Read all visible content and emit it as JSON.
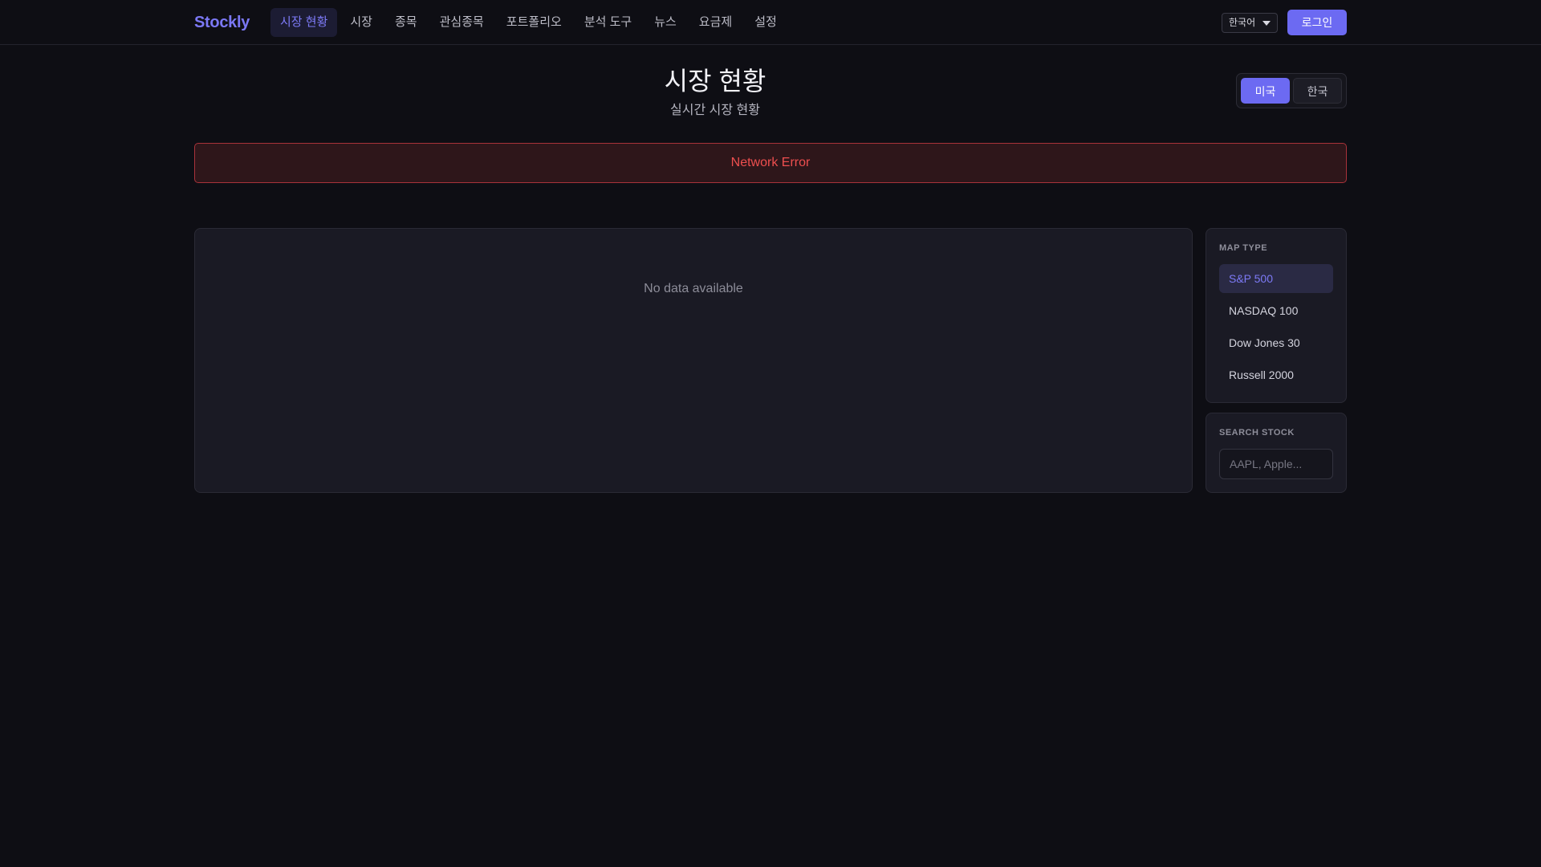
{
  "brand": "Stockly",
  "nav": {
    "items": [
      {
        "label": "시장 현황",
        "active": true
      },
      {
        "label": "시장",
        "active": false
      },
      {
        "label": "종목",
        "active": false
      },
      {
        "label": "관심종목",
        "active": false
      },
      {
        "label": "포트폴리오",
        "active": false
      },
      {
        "label": "분석 도구",
        "active": false
      },
      {
        "label": "뉴스",
        "active": false
      },
      {
        "label": "요금제",
        "active": false
      },
      {
        "label": "설정",
        "active": false
      }
    ]
  },
  "language": {
    "selected": "한국어"
  },
  "login_label": "로그인",
  "page": {
    "title": "시장 현황",
    "subtitle": "실시간 시장 현황"
  },
  "market_toggle": {
    "options": [
      {
        "label": "미국",
        "active": true
      },
      {
        "label": "한국",
        "active": false
      }
    ]
  },
  "error_message": "Network Error",
  "map_panel": {
    "empty_message": "No data available"
  },
  "map_type": {
    "label": "MAP TYPE",
    "options": [
      {
        "label": "S&P 500",
        "active": true
      },
      {
        "label": "NASDAQ 100",
        "active": false
      },
      {
        "label": "Dow Jones 30",
        "active": false
      },
      {
        "label": "Russell 2000",
        "active": false
      }
    ]
  },
  "search": {
    "label": "SEARCH STOCK",
    "placeholder": "AAPL, Apple...",
    "value": ""
  },
  "colors": {
    "accent": "#6c6af2",
    "background": "#0e0e14",
    "error": "#ee4f4f"
  }
}
